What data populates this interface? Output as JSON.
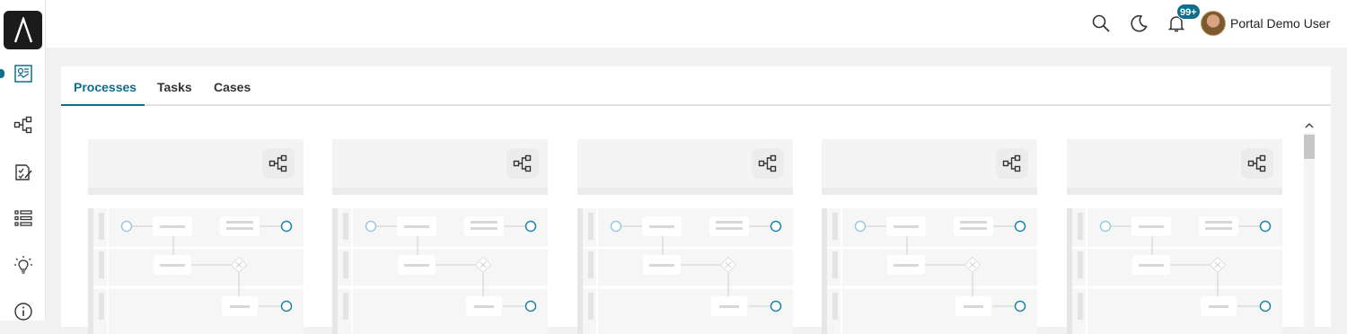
{
  "user": {
    "name": "Portal Demo User",
    "notifications_badge": "99+"
  },
  "tabs": [
    {
      "label": "Processes",
      "active": true
    },
    {
      "label": "Tasks",
      "active": false
    },
    {
      "label": "Cases",
      "active": false
    }
  ],
  "sidebar": {
    "items": [
      {
        "icon": "dashboard-icon",
        "active": true
      },
      {
        "icon": "process-icon",
        "active": false
      },
      {
        "icon": "task-icon",
        "active": false
      },
      {
        "icon": "case-list-icon",
        "active": false
      },
      {
        "icon": "lightbulb-icon",
        "active": false
      },
      {
        "icon": "info-icon",
        "active": false
      }
    ]
  },
  "topbar_icons": [
    "search-icon",
    "moon-icon",
    "bell-icon"
  ],
  "process_cards": [
    {
      "id": 1,
      "action_icon": "process-flow-icon"
    },
    {
      "id": 2,
      "action_icon": "process-flow-icon"
    },
    {
      "id": 3,
      "action_icon": "process-flow-icon"
    },
    {
      "id": 4,
      "action_icon": "process-flow-icon"
    },
    {
      "id": 5,
      "action_icon": "process-flow-icon"
    }
  ],
  "colors": {
    "accent": "#0e6e8c",
    "logo_bg": "#1b1b1b"
  }
}
